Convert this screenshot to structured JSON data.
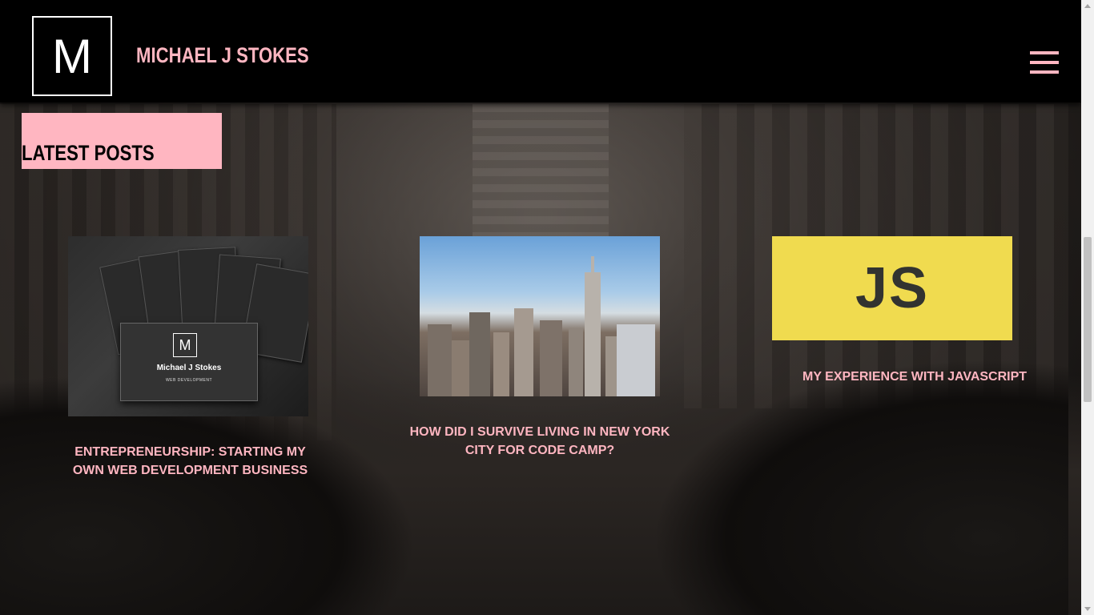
{
  "header": {
    "logo_letter": "M",
    "site_title": "MICHAEL J STOKES",
    "menu_icon": "hamburger-menu-icon"
  },
  "latest": {
    "heading": "LATEST POSTS"
  },
  "posts": [
    {
      "title": "ENTREPRENEURSHIP: STARTING MY OWN WEB DEVELOPMENT BUSINESS",
      "card_logo": "M",
      "card_name": "Michael J Stokes",
      "card_sub": "WEB DEVELOPMENT"
    },
    {
      "title": "HOW DID I SURVIVE LIVING IN NEW YORK CITY FOR CODE CAMP?"
    },
    {
      "title": "MY EXPERIENCE WITH JAVASCRIPT",
      "logo_text": "JS"
    }
  ],
  "colors": {
    "accent_pink": "#ffb6c1",
    "header_bg": "#000000",
    "js_yellow": "#f0db4f"
  }
}
